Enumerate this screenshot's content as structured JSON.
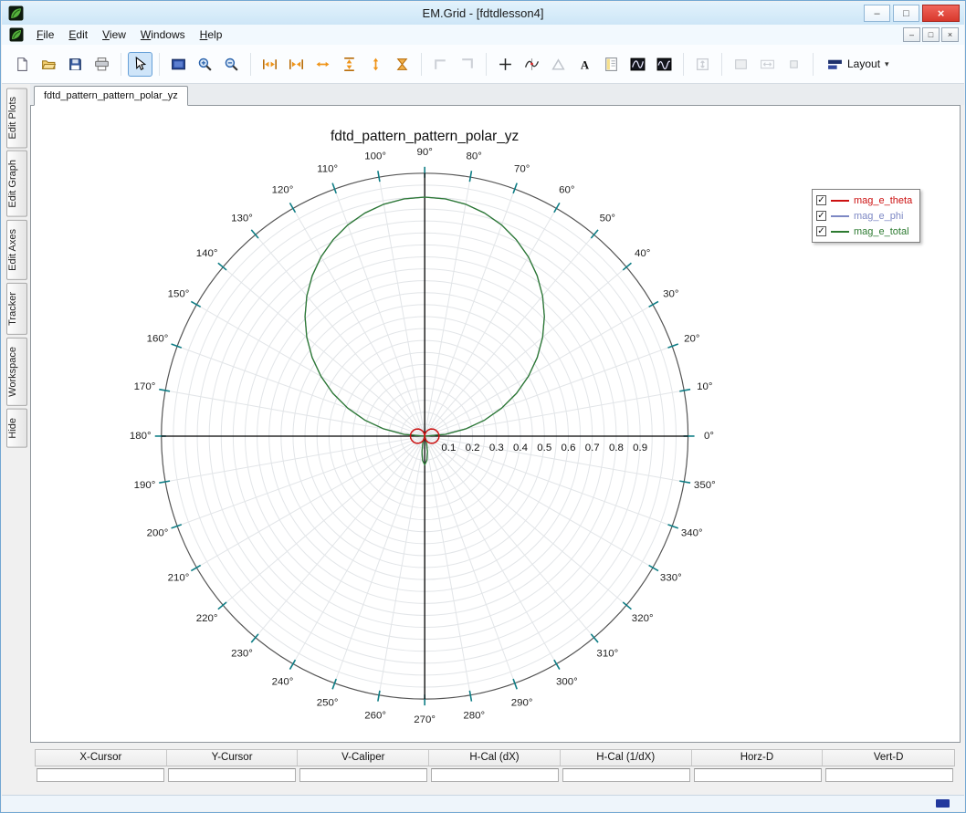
{
  "window": {
    "title": "EM.Grid - [fdtdlesson4]",
    "controls": {
      "minimize": "–",
      "maximize": "□",
      "close": "×"
    }
  },
  "menu": {
    "items": [
      {
        "label": "File",
        "underline": 0
      },
      {
        "label": "Edit",
        "underline": 0
      },
      {
        "label": "View",
        "underline": 0
      },
      {
        "label": "Windows",
        "underline": 0
      },
      {
        "label": "Help",
        "underline": 0
      }
    ]
  },
  "mdi_controls": {
    "minimize": "–",
    "restore": "□",
    "close": "×"
  },
  "toolbar": {
    "items": [
      {
        "name": "new-file",
        "icon": "page"
      },
      {
        "name": "open-file",
        "icon": "folder"
      },
      {
        "name": "save-file",
        "icon": "floppy"
      },
      {
        "name": "print",
        "icon": "printer"
      },
      {
        "sep": true
      },
      {
        "name": "select-cursor",
        "icon": "cursor",
        "state": "selected"
      },
      {
        "sep": true
      },
      {
        "name": "zoom-window",
        "icon": "zoomrect"
      },
      {
        "name": "zoom-in",
        "icon": "zoomin"
      },
      {
        "name": "zoom-out",
        "icon": "zoomout"
      },
      {
        "sep": true
      },
      {
        "name": "fit-width",
        "icon": "oh_out"
      },
      {
        "name": "compress-width",
        "icon": "oh_in"
      },
      {
        "name": "expand-width",
        "icon": "oh_bars"
      },
      {
        "name": "fit-height",
        "icon": "ov_out"
      },
      {
        "name": "expand-height",
        "icon": "ov_arr"
      },
      {
        "name": "fit-all",
        "icon": "o_sum"
      },
      {
        "sep": true
      },
      {
        "name": "corner-left",
        "icon": "corner1",
        "state": "disabled"
      },
      {
        "name": "corner-right",
        "icon": "corner2",
        "state": "disabled"
      },
      {
        "sep": true
      },
      {
        "name": "crosshair",
        "icon": "plus"
      },
      {
        "name": "trace-picker",
        "icon": "curvepick"
      },
      {
        "name": "triangle-marker",
        "icon": "tri",
        "state": "disabled"
      },
      {
        "name": "text-label",
        "icon": "textA"
      },
      {
        "name": "notes",
        "icon": "note"
      },
      {
        "name": "colormap-1",
        "icon": "wave1"
      },
      {
        "name": "colormap-2",
        "icon": "wave2"
      },
      {
        "sep": true
      },
      {
        "name": "fit-vertical",
        "icon": "gray_v",
        "state": "disabled"
      },
      {
        "sep": true
      },
      {
        "name": "region-box",
        "icon": "gray_box",
        "state": "disabled"
      },
      {
        "name": "h-caliper",
        "icon": "gray_h",
        "state": "disabled"
      },
      {
        "name": "small-box",
        "icon": "gray_small",
        "state": "disabled"
      },
      {
        "sep": true
      },
      {
        "name": "layout",
        "icon": "layout",
        "label": "Layout",
        "caret": "▾"
      }
    ]
  },
  "sidebar": {
    "tabs": [
      "Edit Plots",
      "Edit Graph",
      "Edit Axes",
      "Tracker",
      "Workspace",
      "Hide"
    ]
  },
  "doc_tabs": [
    "fdtd_pattern_pattern_polar_yz"
  ],
  "legend": {
    "check_glyph": "✓",
    "entries": [
      {
        "label": "mag_e_theta",
        "color": "#cc1111",
        "checked": true
      },
      {
        "label": "mag_e_phi",
        "color": "#7d88c4",
        "checked": true
      },
      {
        "label": "mag_e_total",
        "color": "#2d7b31",
        "checked": true
      }
    ]
  },
  "readout": {
    "columns": [
      "X-Cursor",
      "Y-Cursor",
      "V-Caliper",
      "H-Cal (dX)",
      "H-Cal (1/dX)",
      "Horz-D",
      "Vert-D"
    ],
    "values": [
      "",
      "",
      "",
      "",
      "",
      "",
      ""
    ]
  },
  "chart_data": {
    "type": "polar",
    "title": "fdtd_pattern_pattern_polar_yz",
    "r_max": 1.1,
    "r_grid_step": 0.05,
    "angle_label_step_deg": 10,
    "angle_labels": [
      "0°",
      "10°",
      "20°",
      "30°",
      "40°",
      "50°",
      "60°",
      "70°",
      "80°",
      "90°",
      "100°",
      "110°",
      "120°",
      "130°",
      "140°",
      "150°",
      "160°",
      "170°",
      "180°",
      "190°",
      "200°",
      "210°",
      "220°",
      "230°",
      "240°",
      "250°",
      "260°",
      "270°",
      "280°",
      "290°",
      "300°",
      "310°",
      "320°",
      "330°",
      "340°",
      "350°"
    ],
    "radial_labels": [
      "0.1",
      "0.2",
      "0.3",
      "0.4",
      "0.5",
      "0.6",
      "0.7",
      "0.8",
      "0.9"
    ],
    "grid": true,
    "legend_position": "top-right",
    "draw_order": [
      "mag_e_phi",
      "mag_e_total",
      "mag_e_theta"
    ],
    "series": [
      {
        "name": "mag_e_theta",
        "color": "#cc1111",
        "points": [
          [
            0,
            0.06
          ],
          [
            10,
            0.059
          ],
          [
            20,
            0.056
          ],
          [
            30,
            0.052
          ],
          [
            40,
            0.046
          ],
          [
            50,
            0.039
          ],
          [
            60,
            0.03
          ],
          [
            70,
            0.021
          ],
          [
            80,
            0.01
          ],
          [
            90,
            0
          ],
          [
            100,
            0.01
          ],
          [
            110,
            0.021
          ],
          [
            120,
            0.03
          ],
          [
            130,
            0.039
          ],
          [
            140,
            0.046
          ],
          [
            150,
            0.052
          ],
          [
            160,
            0.056
          ],
          [
            170,
            0.059
          ],
          [
            180,
            0.06
          ],
          [
            190,
            0.059
          ],
          [
            200,
            0.056
          ],
          [
            210,
            0.052
          ],
          [
            220,
            0.046
          ],
          [
            230,
            0.039
          ],
          [
            240,
            0.03
          ],
          [
            250,
            0.021
          ],
          [
            260,
            0.01
          ],
          [
            270,
            0
          ],
          [
            280,
            0.01
          ],
          [
            290,
            0.021
          ],
          [
            300,
            0.03
          ],
          [
            310,
            0.039
          ],
          [
            320,
            0.046
          ],
          [
            330,
            0.052
          ],
          [
            340,
            0.056
          ],
          [
            350,
            0.059
          ]
        ]
      },
      {
        "name": "mag_e_phi",
        "color": "#7d88c4",
        "points": [
          [
            0,
            0
          ],
          [
            5,
            0.087
          ],
          [
            10,
            0.174
          ],
          [
            15,
            0.259
          ],
          [
            20,
            0.342
          ],
          [
            25,
            0.423
          ],
          [
            30,
            0.5
          ],
          [
            35,
            0.574
          ],
          [
            40,
            0.643
          ],
          [
            45,
            0.707
          ],
          [
            50,
            0.766
          ],
          [
            55,
            0.819
          ],
          [
            60,
            0.866
          ],
          [
            65,
            0.906
          ],
          [
            70,
            0.94
          ],
          [
            75,
            0.966
          ],
          [
            80,
            0.985
          ],
          [
            85,
            0.996
          ],
          [
            90,
            1
          ],
          [
            95,
            0.996
          ],
          [
            100,
            0.985
          ],
          [
            105,
            0.966
          ],
          [
            110,
            0.94
          ],
          [
            115,
            0.906
          ],
          [
            120,
            0.866
          ],
          [
            125,
            0.819
          ],
          [
            130,
            0.766
          ],
          [
            135,
            0.707
          ],
          [
            140,
            0.643
          ],
          [
            145,
            0.574
          ],
          [
            150,
            0.5
          ],
          [
            155,
            0.423
          ],
          [
            160,
            0.342
          ],
          [
            165,
            0.259
          ],
          [
            170,
            0.174
          ],
          [
            175,
            0.087
          ],
          [
            180,
            0
          ],
          [
            185,
            0
          ],
          [
            190,
            0
          ],
          [
            195,
            0
          ],
          [
            200,
            0
          ],
          [
            205,
            0
          ],
          [
            210,
            0
          ],
          [
            215,
            0
          ],
          [
            220,
            0
          ],
          [
            225,
            0
          ],
          [
            230,
            0
          ],
          [
            235,
            0
          ],
          [
            240,
            0
          ],
          [
            245,
            0.002
          ],
          [
            250,
            0.01
          ],
          [
            255,
            0.03
          ],
          [
            260,
            0.066
          ],
          [
            265,
            0.102
          ],
          [
            270,
            0.12
          ],
          [
            275,
            0.102
          ],
          [
            280,
            0.066
          ],
          [
            285,
            0.03
          ],
          [
            290,
            0.01
          ],
          [
            295,
            0.002
          ],
          [
            300,
            0
          ],
          [
            305,
            0
          ],
          [
            310,
            0
          ],
          [
            315,
            0
          ],
          [
            320,
            0
          ],
          [
            325,
            0
          ],
          [
            330,
            0
          ],
          [
            335,
            0
          ],
          [
            340,
            0
          ],
          [
            345,
            0
          ],
          [
            350,
            0
          ],
          [
            355,
            0
          ]
        ]
      },
      {
        "name": "mag_e_total",
        "color": "#2d7b31",
        "points": [
          [
            0,
            0
          ],
          [
            5,
            0.087
          ],
          [
            10,
            0.174
          ],
          [
            15,
            0.259
          ],
          [
            20,
            0.342
          ],
          [
            25,
            0.423
          ],
          [
            30,
            0.5
          ],
          [
            35,
            0.574
          ],
          [
            40,
            0.643
          ],
          [
            45,
            0.707
          ],
          [
            50,
            0.766
          ],
          [
            55,
            0.819
          ],
          [
            60,
            0.866
          ],
          [
            65,
            0.906
          ],
          [
            70,
            0.94
          ],
          [
            75,
            0.966
          ],
          [
            80,
            0.985
          ],
          [
            85,
            0.996
          ],
          [
            90,
            1
          ],
          [
            95,
            0.996
          ],
          [
            100,
            0.985
          ],
          [
            105,
            0.966
          ],
          [
            110,
            0.94
          ],
          [
            115,
            0.906
          ],
          [
            120,
            0.866
          ],
          [
            125,
            0.819
          ],
          [
            130,
            0.766
          ],
          [
            135,
            0.707
          ],
          [
            140,
            0.643
          ],
          [
            145,
            0.574
          ],
          [
            150,
            0.5
          ],
          [
            155,
            0.423
          ],
          [
            160,
            0.342
          ],
          [
            165,
            0.259
          ],
          [
            170,
            0.174
          ],
          [
            175,
            0.087
          ],
          [
            180,
            0
          ],
          [
            185,
            0
          ],
          [
            190,
            0
          ],
          [
            195,
            0
          ],
          [
            200,
            0
          ],
          [
            205,
            0
          ],
          [
            210,
            0
          ],
          [
            215,
            0
          ],
          [
            220,
            0
          ],
          [
            225,
            0
          ],
          [
            230,
            0
          ],
          [
            235,
            0
          ],
          [
            240,
            0
          ],
          [
            245,
            0.002
          ],
          [
            250,
            0.01
          ],
          [
            255,
            0.03
          ],
          [
            260,
            0.066
          ],
          [
            265,
            0.102
          ],
          [
            270,
            0.12
          ],
          [
            275,
            0.102
          ],
          [
            280,
            0.066
          ],
          [
            285,
            0.03
          ],
          [
            290,
            0.01
          ],
          [
            295,
            0.002
          ],
          [
            300,
            0
          ],
          [
            305,
            0
          ],
          [
            310,
            0
          ],
          [
            315,
            0
          ],
          [
            320,
            0
          ],
          [
            325,
            0
          ],
          [
            330,
            0
          ],
          [
            335,
            0
          ],
          [
            340,
            0
          ],
          [
            345,
            0
          ],
          [
            350,
            0
          ],
          [
            355,
            0
          ]
        ]
      }
    ]
  }
}
